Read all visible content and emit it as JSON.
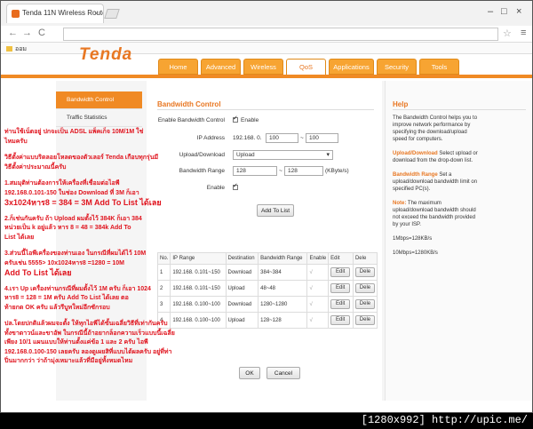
{
  "browser": {
    "tab_title": "Tenda 11N Wireless Router",
    "tab_close": "×",
    "url": "",
    "bookmark_label": "ออม",
    "back": "←",
    "forward": "→",
    "reload": "C",
    "star": "☆",
    "menu": "≡",
    "minimize": "–",
    "maximize": "□",
    "close": "×"
  },
  "brand": {
    "logo": "Tenda",
    "accent": "#f08a24"
  },
  "nav": {
    "tabs": [
      {
        "label": "Home"
      },
      {
        "label": "Advanced"
      },
      {
        "label": "Wireless"
      },
      {
        "label": "QoS"
      },
      {
        "label": "Applications"
      },
      {
        "label": "Security"
      },
      {
        "label": "Tools"
      }
    ]
  },
  "sidebar": {
    "items": [
      {
        "label": "Bandwidth Control"
      },
      {
        "label": "Traffic Statistics"
      }
    ]
  },
  "form": {
    "section_title": "Bandwidth Control",
    "enable_label": "Enable Bandwidth Control",
    "enable_text": "Enable",
    "ip_label": "IP Address",
    "ip_prefix": "192.168. 0.",
    "ip_start": "100",
    "ip_sep": "~",
    "ip_end": "100",
    "direction_label": "Upload/Download",
    "direction_value": "Upload",
    "range_label": "Bandwidth Range",
    "range_min": "128",
    "range_sep": "~",
    "range_max": "128",
    "range_unit": "(KByte/s)",
    "enable2_label": "Enable",
    "add_button": "Add To List"
  },
  "table": {
    "headers": [
      "No.",
      "IP Range",
      "Destination",
      "Bandwidth Range",
      "Enable",
      "Edit",
      "Dele"
    ],
    "rows": [
      {
        "no": "1",
        "ip": "192.168. 0.101~150",
        "dest": "Download",
        "bw": "384~384",
        "en": "√",
        "edit": "Edit",
        "del": "Dele"
      },
      {
        "no": "2",
        "ip": "192.168. 0.101~150",
        "dest": "Upload",
        "bw": "48~48",
        "en": "√",
        "edit": "Edit",
        "del": "Dele"
      },
      {
        "no": "3",
        "ip": "192.168. 0.100~100",
        "dest": "Download",
        "bw": "1280~1280",
        "en": "√",
        "edit": "Edit",
        "del": "Dele"
      },
      {
        "no": "4",
        "ip": "192.168. 0.100~100",
        "dest": "Upload",
        "bw": "128~128",
        "en": "√",
        "edit": "Edit",
        "del": "Dele"
      }
    ]
  },
  "actions": {
    "ok": "OK",
    "cancel": "Cancel"
  },
  "help": {
    "title": "Help",
    "p1": "The Bandwidth Control helps you to improve network performance by specifying the download/upload speed for computers.",
    "p2_bold": "Upload/Download",
    "p2": "Select upload or download from the drop-down list.",
    "p3_bold": "Bandwidth Range",
    "p3": "Set a upload/download bandwidth limit on specified PC(s).",
    "p4_bold": "Note:",
    "p4": "The maximum upload/download bandwidth should not exceed the bandwidth provided by your ISP.",
    "p5": "1Mbps=128KB/s",
    "p6": "10Mbps=1280KB/s"
  },
  "overlay": {
    "l1": "ท่านใช้เน็ตอยู่ ปกจะเป็น ADSL แพ็คเก็จ 10M/1M ใช่",
    "l2": "ไหมครับ",
    "l3": "วิธีตั้งค่าแบบริดลอยโหลดของตัวเลอร์ Tenda เกือบทุกรุ่นมี",
    "l4": "วิธีตั้งค่าประมาณนี้ครับ",
    "l5": "1.สมมุติท่านต้องการให้เครื่องที่เชื่อมต่อไอพี",
    "l6": "192.168.0.101-150 ในช่อง Download ที่ 3M ก็เอา",
    "l7": "3x1024หาร8 = 384 = 3M Add To List ได้เลย",
    "l8": "2.ก็เช่นกันครับ ถ้า Upload ผมตั้งไว้ 384K ก็เอา 384",
    "l9": "หน่วยเป็น k อยู่แล้ว หาร 8 = 48 = 384k Add To",
    "l10": "List ได้เลย",
    "l11": "3.ส่วนนี้ไอพีเครื่องของท่านเอง ในกรณีที่ผมได้ไว้ 10M",
    "l12": "ครับเช่น 5555> 10x1024หาร8 =1280 = 10M",
    "l13": "Add To List ได้เลย",
    "l14": "4.เรา Up เครื่องท่านกรณีที่ผมตั้งไว้ 1M ครับ ก็เอา 1024",
    "l15": "หาร8 = 128 = 1M ครับ Add To List ได้เลย ตอ",
    "l16": "ท้ายกด OK ครับ แล้วรีบูทใหม่อีกซักรอบ",
    "l17": "ปล.โดยปกติแล้วผมจะตั้ง ให้ทุกไอพีได้ขั้นเฉลี่ยวิธีที่เท่ากันครับ",
    "l18": "ทั้งขาดาวน์และขาอัพ ในกรณีนี้ถ้าอยากล็อกความเร็วแบบนี้เฉลี่ย",
    "l19": "เพียง 10/1 แผนแบบให้ท่านตั้งแค่ข้อ 1 และ 2 ครับ ไอพี",
    "l20": "192.168.0.100-150 เลยครับ ลองดูเผยสิที่แบบได้ผลครับ อยู่ที่ท่า",
    "l21": "ปิ่นมากกว่า ว่าถ้ามุ่งเหมาะแล้วที่มีอยู่ทั้งหมดไหม"
  },
  "watermark": "[1280x992] http://upic.me/"
}
